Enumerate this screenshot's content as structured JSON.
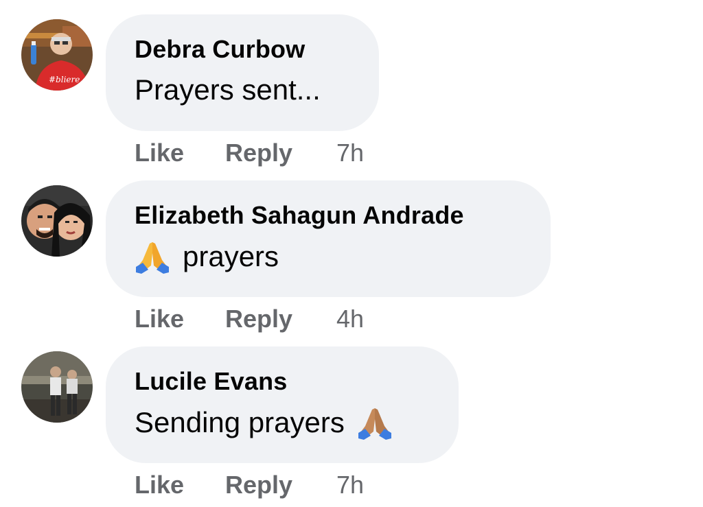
{
  "comments": [
    {
      "author": "Debra Curbow",
      "text": "Prayers sent...",
      "emoji_before": false,
      "emoji_after": false,
      "like_label": "Like",
      "reply_label": "Reply",
      "time": "7h"
    },
    {
      "author": "Elizabeth Sahagun Andrade",
      "text": "prayers",
      "emoji_before": true,
      "emoji_after": false,
      "like_label": "Like",
      "reply_label": "Reply",
      "time": "4h"
    },
    {
      "author": "Lucile Evans",
      "text": "Sending prayers",
      "emoji_before": false,
      "emoji_after": true,
      "like_label": "Like",
      "reply_label": "Reply",
      "time": "7h"
    }
  ],
  "colors": {
    "bubble": "#f0f2f5",
    "text": "#050505",
    "muted": "#65676b"
  },
  "icons": {
    "emoji": "folded-hands-icon"
  }
}
